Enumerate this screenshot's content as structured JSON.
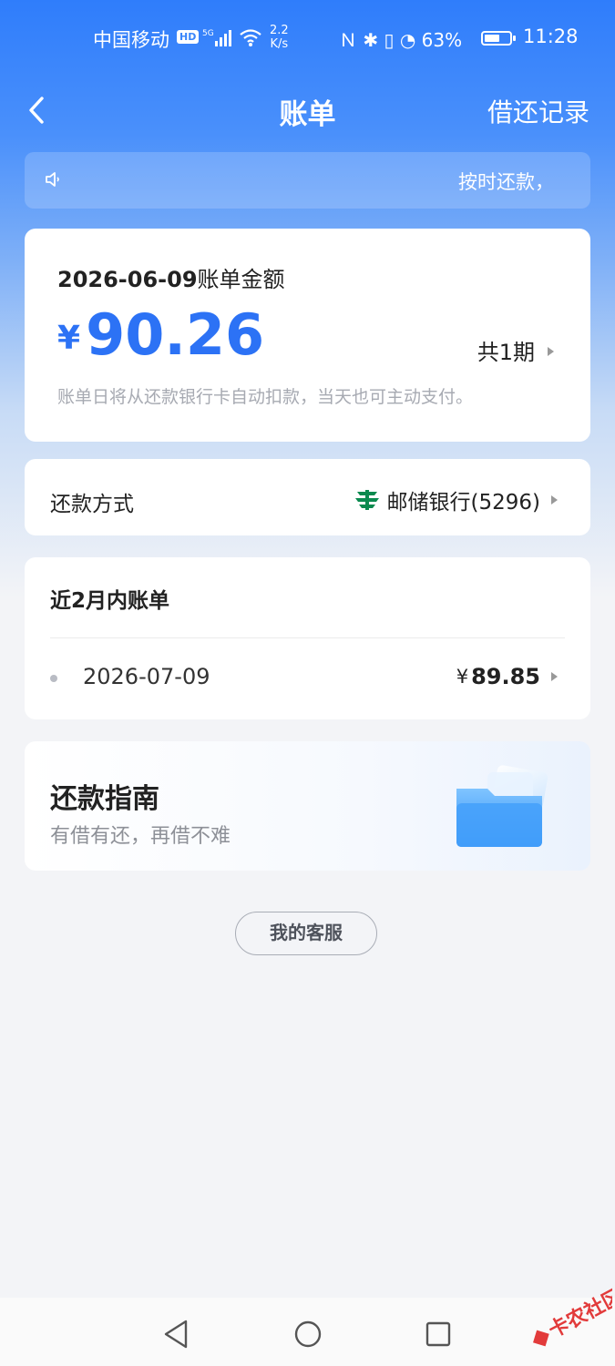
{
  "status_bar": {
    "carrier": "中国移动",
    "hd": "HD",
    "net_speed": "2.2",
    "net_unit": "K/s",
    "battery": "63%",
    "battery_level": 0.63,
    "time": "11:28"
  },
  "nav": {
    "title": "账单",
    "record_link": "借还记录"
  },
  "notice": {
    "text": "按时还款，"
  },
  "bill": {
    "date": "2026-06-09",
    "title_suffix": "账单金额",
    "currency": "¥",
    "amount": "90.26",
    "periods": "共1期",
    "hint": "账单日将从还款银行卡自动扣款，当天也可主动支付。"
  },
  "payment": {
    "label": "还款方式",
    "bank": "邮储银行(5296)"
  },
  "recent": {
    "title": "近2月内账单",
    "items": [
      {
        "date": "2026-07-09",
        "currency": "¥",
        "amount": "89.85"
      }
    ]
  },
  "guide": {
    "title": "还款指南",
    "subtitle": "有借有还，再借不难"
  },
  "service_button": "我的客服",
  "colors": {
    "brand_blue": "#2c72f5",
    "bank_green": "#0b8a4f"
  }
}
